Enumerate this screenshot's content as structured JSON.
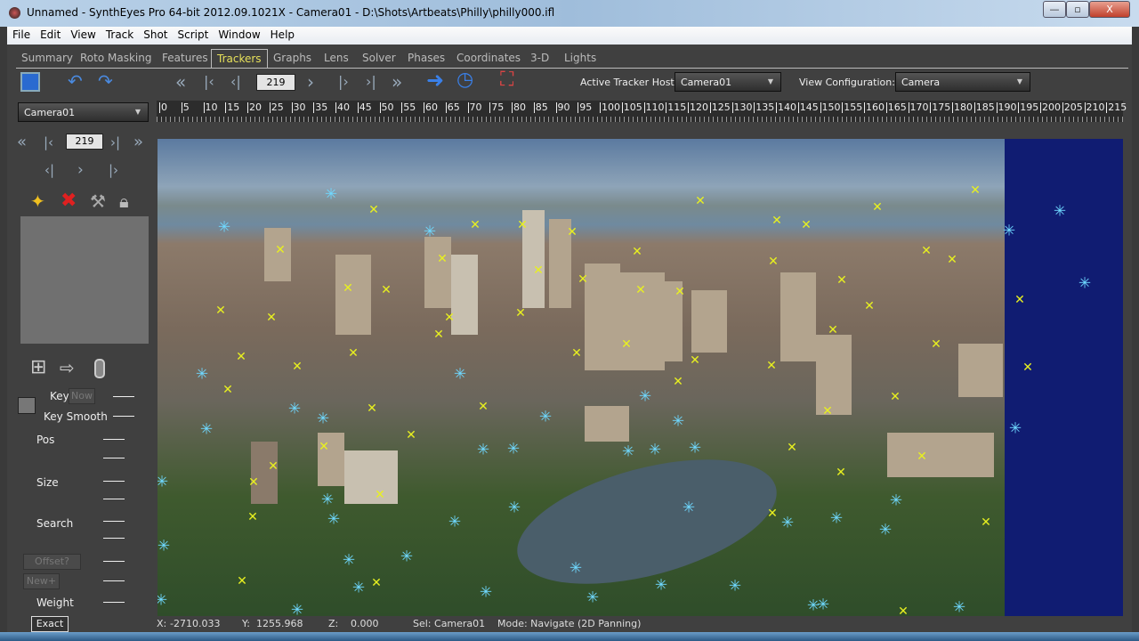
{
  "window": {
    "title": "Unnamed - SynthEyes Pro 64-bit 2012.09.1021X - Camera01 - D:\\Shots\\Artbeats\\Philly\\philly000.ifl",
    "minimize": "—",
    "maximize": "▫",
    "close": "X"
  },
  "menu": [
    "File",
    "Edit",
    "View",
    "Track",
    "Shot",
    "Script",
    "Window",
    "Help"
  ],
  "tabs": [
    "Summary",
    "Roto Masking",
    "Features",
    "Trackers",
    "Graphs",
    "Lens",
    "Solver",
    "Phases",
    "Coordinates",
    "3-D",
    "Lights"
  ],
  "active_tab": "Trackers",
  "toolbar": {
    "frame": "219",
    "active_tracker_host_label": "Active Tracker Host:",
    "active_tracker_host": "Camera01",
    "view_config_label": "View Configuration:",
    "view_config": "Camera"
  },
  "shot_select": "Camera01",
  "ruler": [
    "0",
    "5",
    "10",
    "15",
    "20",
    "25",
    "30",
    "35",
    "40",
    "45",
    "50",
    "55",
    "60",
    "65",
    "70",
    "75",
    "80",
    "85",
    "90",
    "95",
    "100",
    "105",
    "110",
    "115",
    "120",
    "125",
    "130",
    "135",
    "140",
    "145",
    "150",
    "155",
    "160",
    "165",
    "170",
    "175",
    "180",
    "185",
    "190",
    "195",
    "200",
    "205",
    "210",
    "215"
  ],
  "panel": {
    "frame": "219",
    "key": "Key",
    "now": "Now",
    "key_smooth": "Key Smooth",
    "pos": "Pos",
    "size": "Size",
    "search": "Search",
    "offset": "Offset?",
    "new": "New+",
    "weight": "Weight",
    "exact": "Exact"
  },
  "status": {
    "x_label": "X:",
    "x": "-2710.033",
    "y_label": "Y:",
    "y": "1255.968",
    "z_label": "Z:",
    "z": "0.000",
    "sel": "Sel: Camera01",
    "mode": "Mode: Navigate (2D Panning)"
  }
}
